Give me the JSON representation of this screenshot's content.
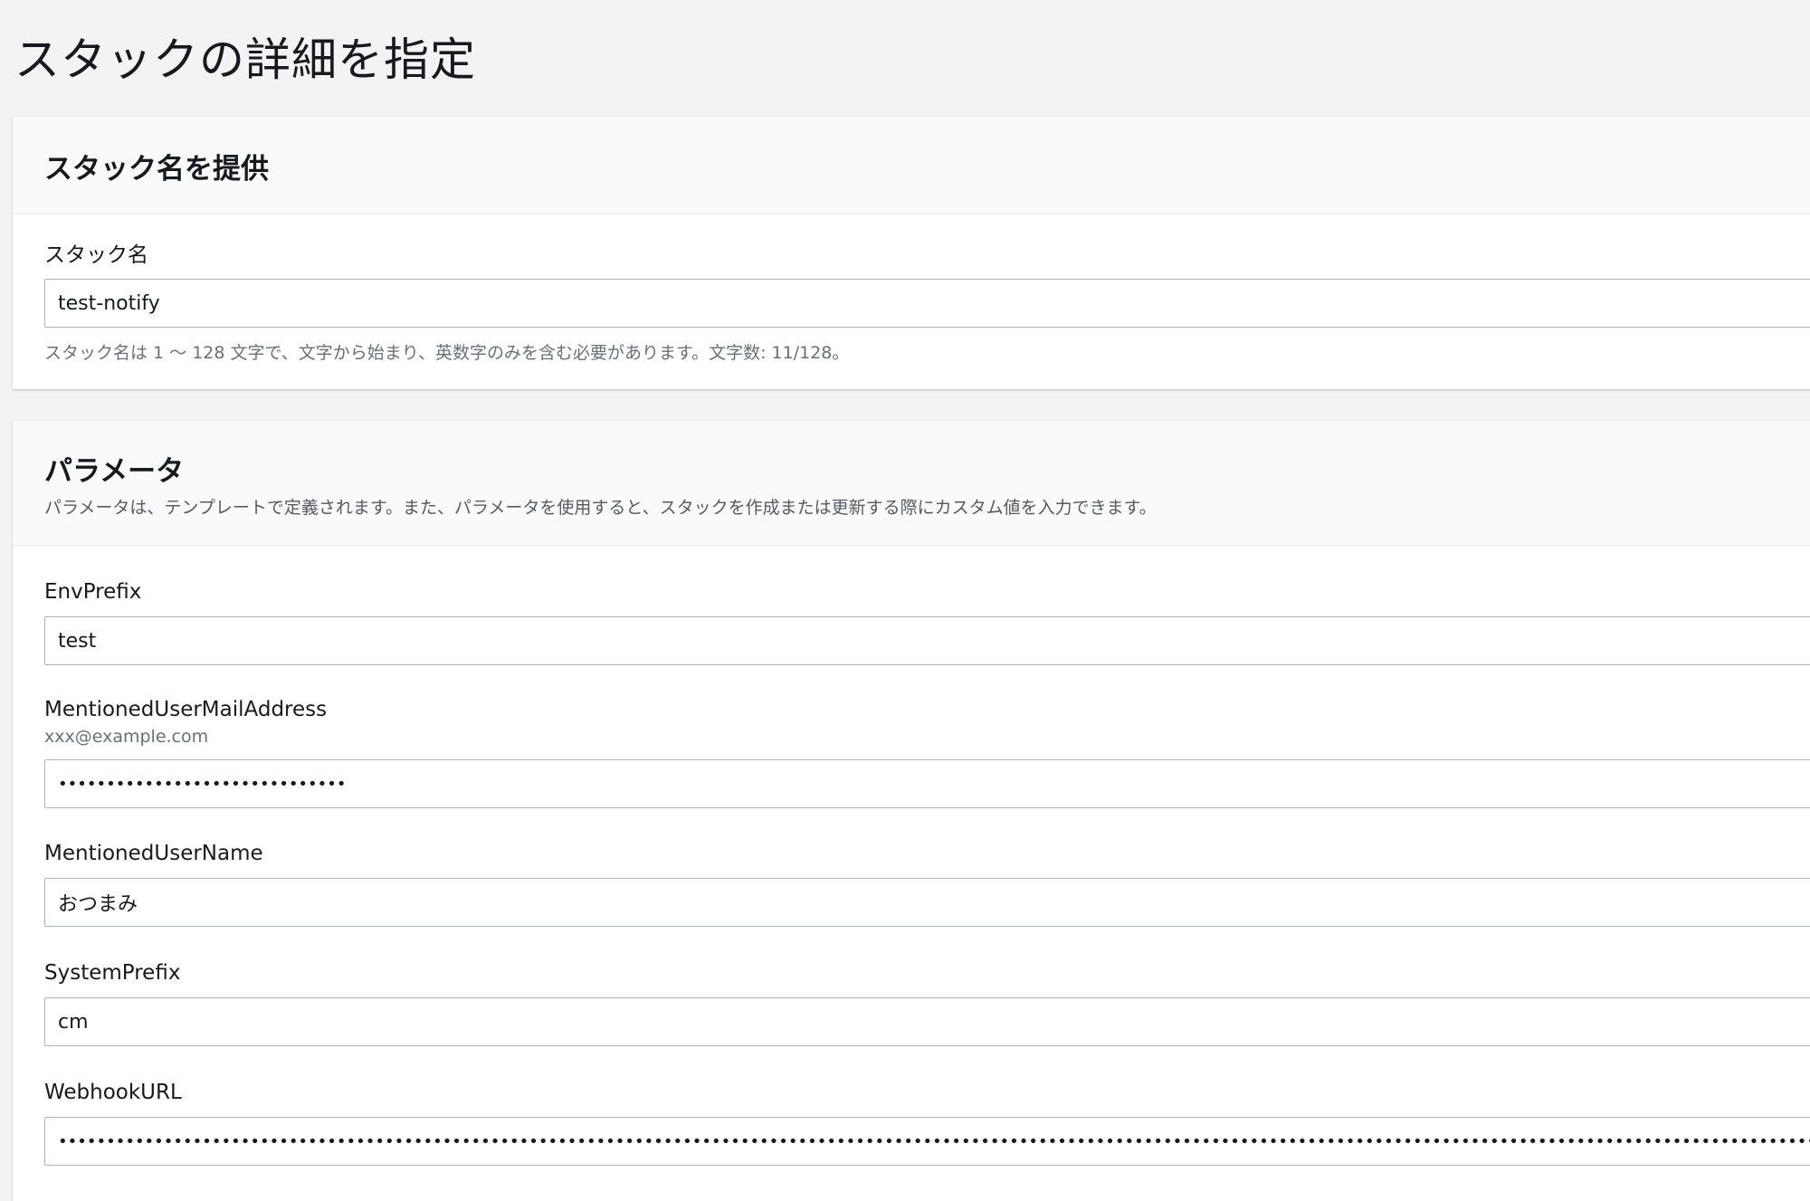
{
  "page": {
    "title": "スタックの詳細を指定"
  },
  "stack_name_panel": {
    "title": "スタック名を提供",
    "field_label": "スタック名",
    "value": "test-notify",
    "hint": "スタック名は 1 〜 128 文字で、文字から始まり、英数字のみを含む必要があります。文字数: 11/128。"
  },
  "parameters_panel": {
    "title": "パラメータ",
    "description": "パラメータは、テンプレートで定義されます。また、パラメータを使用すると、スタックを作成または更新する際にカスタム値を入力できます。",
    "fields": [
      {
        "label": "EnvPrefix",
        "description": "",
        "value": "test"
      },
      {
        "label": "MentionedUserMailAddress",
        "description": "xxx@example.com",
        "value": "••••••••••••••••••••••••••••••"
      },
      {
        "label": "MentionedUserName",
        "description": "",
        "value": "おつまみ"
      },
      {
        "label": "SystemPrefix",
        "description": "",
        "value": "cm"
      },
      {
        "label": "WebhookURL",
        "description": "",
        "value": "••••••••••••••••••••••••••••••••••••••••••••••••••••••••••••••••••••••••••••••••••••••••••••••••••••••••••••••••••••••••••••••••••••••••••••••••••••••••••••••••••••••••••••••••••••••••••••••••••••••••••"
      }
    ]
  }
}
